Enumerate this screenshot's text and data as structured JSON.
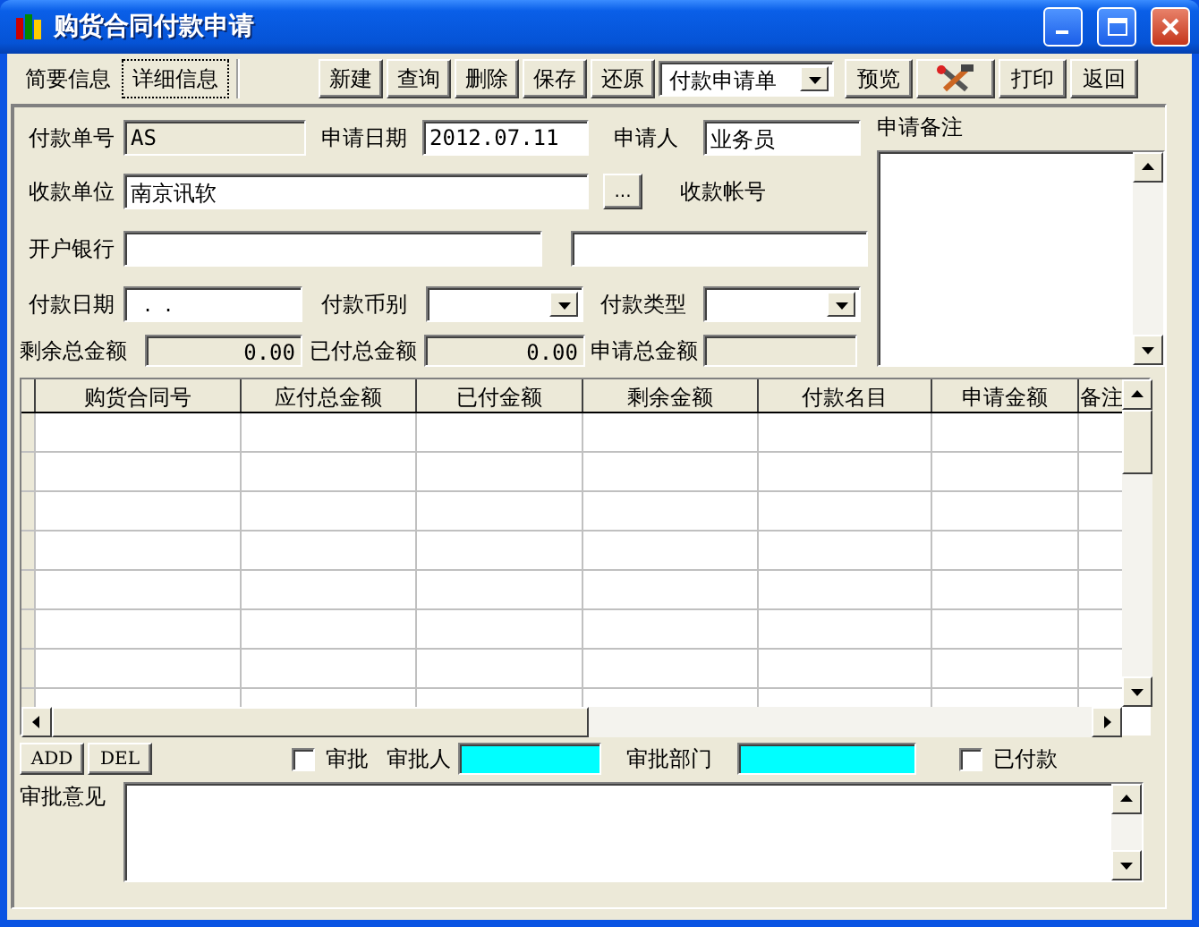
{
  "window": {
    "title": "购货合同付款申请"
  },
  "tabs": [
    {
      "label": "简要信息",
      "selected": false
    },
    {
      "label": "详细信息",
      "selected": true
    }
  ],
  "toolbar": {
    "buttons_left": [
      "新建",
      "查询",
      "删除",
      "保存",
      "还原"
    ],
    "report_select": "付款申请单",
    "buttons_right": [
      {
        "kind": "text",
        "label": "预览"
      },
      {
        "kind": "icon"
      },
      {
        "kind": "text",
        "label": "打印"
      },
      {
        "kind": "text",
        "label": "返回"
      }
    ]
  },
  "form": {
    "payment_no": {
      "label": "付款单号",
      "value": "AS",
      "readonly": true
    },
    "apply_date": {
      "label": "申请日期",
      "value": "2012.07.11",
      "readonly": false
    },
    "applicant": {
      "label": "申请人",
      "value": "业务员",
      "readonly": false
    },
    "payee": {
      "label": "收款单位",
      "value": "南京讯软",
      "readonly": false
    },
    "browse_button": "...",
    "account_label": "收款帐号",
    "bank": {
      "label": "开户银行",
      "readonly": false
    },
    "pay_date": {
      "label": "付款日期",
      "value": "  .  .",
      "readonly": false
    },
    "currency": {
      "label": "付款币别"
    },
    "pay_type": {
      "label": "付款类型"
    },
    "remaining_total": {
      "label": "剩余总金额",
      "value": "0.00",
      "readonly": true
    },
    "paid_total": {
      "label": "已付总金额",
      "value": "0.00",
      "readonly": true
    },
    "apply_total": {
      "label": "申请总金额",
      "readonly": true
    },
    "notes_label": "申请备注"
  },
  "table": {
    "columns": [
      "购货合同号",
      "应付总金额",
      "已付金额",
      "剩余金额",
      "付款名目",
      "申请金额",
      "备注"
    ]
  },
  "bottom": {
    "buttons": [
      "ADD",
      "DEL"
    ],
    "approve": {
      "label": "审批",
      "checked": false
    },
    "approver": {
      "label": "审批人",
      "color": "#00ffff"
    },
    "dept": {
      "label": "审批部门",
      "color": "#00ffff"
    },
    "paid": {
      "label": "已付款",
      "checked": false
    },
    "opinion_label": "审批意见"
  }
}
